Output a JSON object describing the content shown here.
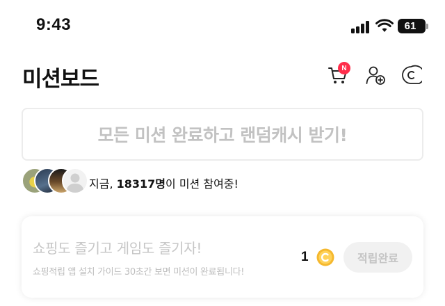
{
  "status_bar": {
    "time": "9:43",
    "battery": "61"
  },
  "header": {
    "title": "미션보드",
    "cart_badge": "N"
  },
  "bonus_banner": {
    "text": "모든 미션 완료하고 랜덤캐시 받기!"
  },
  "participants": {
    "prefix": "지금, ",
    "count": "18317명",
    "suffix": "이 미션 참여중!"
  },
  "missions": [
    {
      "title": "쇼핑도 즐기고 게임도 즐기자!",
      "description": "쇼핑적립 앱 설치 가이드 30초간 보면 미션이 완료됩니다!",
      "reward": "1",
      "button_label": "적립완료"
    }
  ],
  "colors": {
    "badge": "#ff2d4b",
    "coin": "#f5b82e",
    "disabled_text": "#c4c4c4"
  },
  "icons": [
    "cart-icon",
    "add-friend-icon",
    "cash-coin-icon",
    "coin-icon"
  ]
}
